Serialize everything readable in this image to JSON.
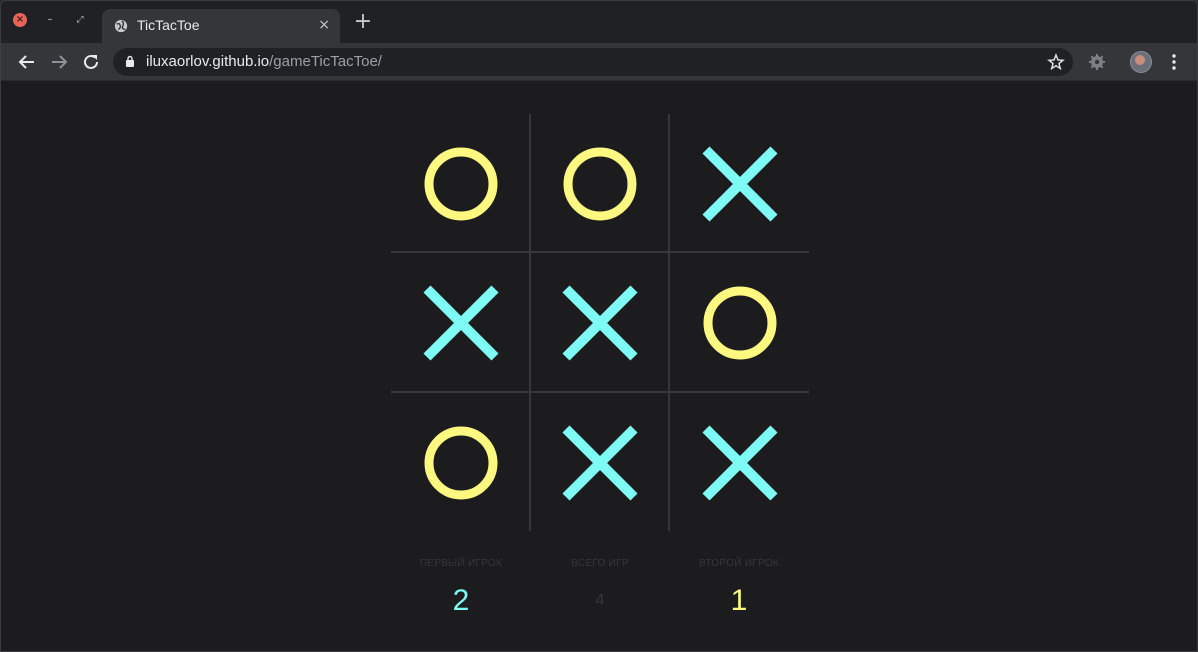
{
  "browser": {
    "tab_title": "TicTacToe",
    "url_host": "iluxaorlov.github.io",
    "url_path": "/gameTicTacToe/",
    "close_icon": "×",
    "newtab_icon": "+"
  },
  "colors": {
    "x_color": "#7efbf5",
    "o_color": "#fdf87f",
    "background": "#1c1b1e",
    "grid": "#38373c"
  },
  "game": {
    "board": [
      "O",
      "O",
      "X",
      "X",
      "X",
      "O",
      "O",
      "X",
      "X"
    ]
  },
  "scoreboard": {
    "player1_label": "ПЕРВЫЙ ИГРОК",
    "player1_score": "2",
    "total_label": "ВСЕГО ИГР",
    "total_score": "4",
    "player2_label": "ВТОРОЙ ИГРОК",
    "player2_score": "1"
  }
}
